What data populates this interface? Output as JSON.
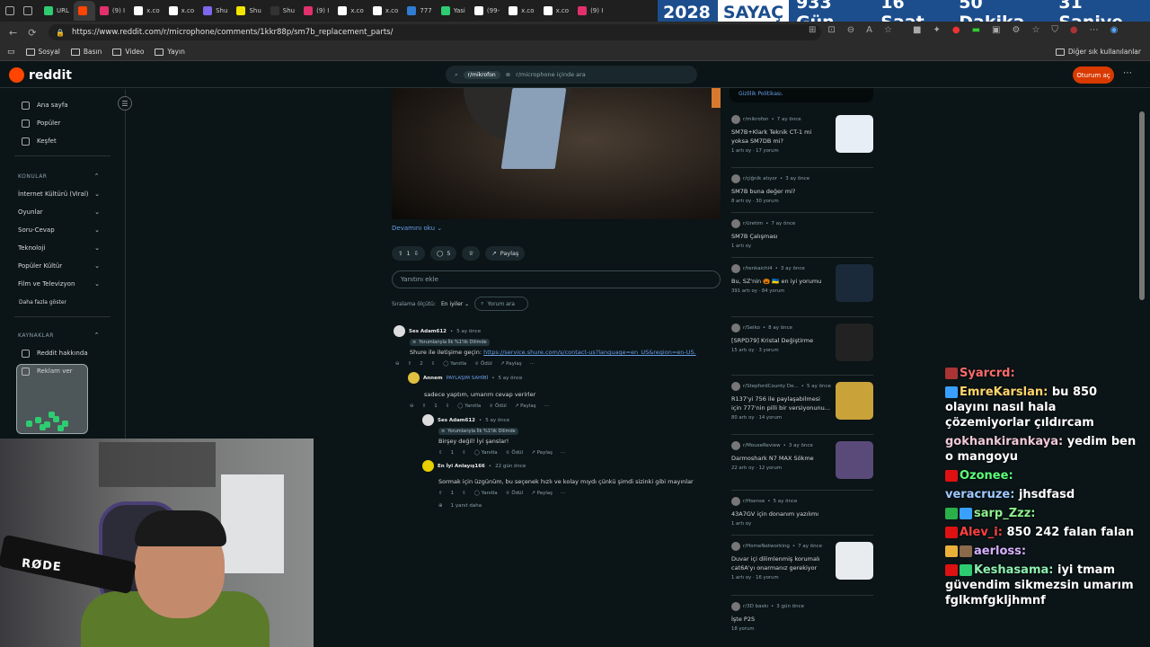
{
  "browser": {
    "tabs": [
      {
        "label": "URL",
        "color": "#2ecc71",
        "active": false
      },
      {
        "label": "",
        "color": "#ff4500",
        "active": true
      },
      {
        "label": "(9) I",
        "color": "#e1306c",
        "active": false
      },
      {
        "label": "x.co",
        "color": "#ffffff",
        "active": false
      },
      {
        "label": "x.co",
        "color": "#ffffff",
        "active": false
      },
      {
        "label": "Shu",
        "color": "#7b68ee",
        "active": false
      },
      {
        "label": "Shu",
        "color": "#f2e500",
        "active": false
      },
      {
        "label": "Shu",
        "color": "#333333",
        "active": false
      },
      {
        "label": "(9) I",
        "color": "#e1306c",
        "active": false
      },
      {
        "label": "x.co",
        "color": "#ffffff",
        "active": false
      },
      {
        "label": "x.co",
        "color": "#ffffff",
        "active": false
      },
      {
        "label": "777",
        "color": "#2e7dd1",
        "active": false
      },
      {
        "label": "Yasi",
        "color": "#2ecc71",
        "active": false
      },
      {
        "label": "(99-",
        "color": "#ffffff",
        "active": false
      },
      {
        "label": "x.co",
        "color": "#ffffff",
        "active": false
      },
      {
        "label": "x.co",
        "color": "#ffffff",
        "active": false
      },
      {
        "label": "(9) I",
        "color": "#e1306c",
        "active": false
      }
    ],
    "url": "https://www.reddit.com/r/microphone/comments/1kkr88p/sm7b_replacement_parts/",
    "bookmarks": [
      "Sosyal",
      "Basın",
      "Video",
      "Yayın"
    ],
    "other_bookmarks": "Diğer sık kullanılanlar"
  },
  "counter": {
    "year": "2028",
    "label": "SAYAÇ",
    "days": "933 Gün",
    "hours": "16 Saat",
    "minutes": "50 Dakika",
    "seconds": "31 Saniye"
  },
  "reddit": {
    "logo": "reddit",
    "search_chip": "r/mikrofon",
    "search_placeholder": "r/microphone içinde ara",
    "login": "Oturum aç",
    "nav": [
      "Ana sayfa",
      "Popüler",
      "Keşfet"
    ],
    "topics_header": "KONULAR",
    "topics": [
      "İnternet Kültürü (Viral)",
      "Oyunlar",
      "Soru-Cevap",
      "Teknoloji",
      "Popüler Kültür",
      "Film ve Televizyon"
    ],
    "more_topics": "Daha fazla göster",
    "resources_header": "KAYNAKLAR",
    "resources": [
      "Reddit hakkında",
      "Reklam ver"
    ],
    "readmore": "Devamını oku",
    "votes": "1",
    "comments_count": "5",
    "share": "Paylaş",
    "reply_placeholder": "Yanıtını ekle",
    "sort_label": "Sıralama ölçütü:",
    "sort_value": "En iyiler",
    "comment_search": "Yorum ara",
    "comments": [
      {
        "user": "Ses Adam612",
        "time": "5 ay önce",
        "badge": "Yorumlarıyla İlk %1'lik Dilimde",
        "text": "Shure ile iletişime geçin:",
        "link": "https://service.shure.com/s/contact-us?language=en_US&region=en-US.",
        "votes": "2",
        "reply": "Yanıtla",
        "award": "Ödül",
        "share": "Paylaş"
      },
      {
        "user": "Annem",
        "op": "PAYLAŞIM SAHİBİ",
        "time": "5 ay önce",
        "text": "sadece yaptım, umarım cevap verirler",
        "votes": "1",
        "reply": "Yanıtla",
        "award": "Ödül",
        "share": "Paylaş"
      },
      {
        "user": "Ses Adam612",
        "time": "5 ay önce",
        "badge": "Yorumlarıyla İlk %1'lik Dilimde",
        "text": "Birşey değil! İyi şanslar!",
        "votes": "1",
        "reply": "Yanıtla",
        "award": "Ödül",
        "share": "Paylaş"
      },
      {
        "user": "En İyi Anlayış166",
        "time": "22 gün önce",
        "text": "Sormak için üzgünüm, bu seçenek hızlı ve kolay mıydı çünkü şimdi sizinki gibi mayınlar",
        "votes": "1",
        "reply": "Yanıtla",
        "award": "Ödül",
        "share": "Paylaş",
        "more": "1 yanıt daha"
      }
    ],
    "privacy": "Gizlilik Politikası.",
    "related": [
      {
        "sub": "r/mikrofon",
        "time": "7 ay önce",
        "title": "SM7B+Klark Teknik CT-1 mi yoksa SM7DB mi?",
        "stats": "1 artı oy · 17 yorum",
        "thumb": true,
        "tcolor": "#e8eef5"
      },
      {
        "sub": "r/çiğnik atıyor",
        "time": "3 ay önce",
        "title": "SM7B buna değer mi?",
        "stats": "8 artı oy · 30 yorum",
        "thumb": false
      },
      {
        "sub": "r/üretim",
        "time": "7 ay önce",
        "title": "SM7B Çalışması",
        "stats": "1 artı oy",
        "thumb": false
      },
      {
        "sub": "r/tenkaichi4",
        "time": "3 ay önce",
        "title": "Bu, SZ'nin 🎃 🇺🇦 en iyi yorumu",
        "stats": "391 artı oy · 84 yorum",
        "thumb": true,
        "tcolor": "#1a2a3a"
      },
      {
        "sub": "r/Seiko",
        "time": "8 ay önce",
        "title": "[SRPD79] Kristal Değiştirme",
        "stats": "15 artı oy · 3 yorum",
        "thumb": true,
        "tcolor": "#222222"
      },
      {
        "sub": "r/StepfordCounty De...",
        "time": "5 ay önce",
        "title": "R137'yi 756 ile paylaşabilmesi için 777'nin pilli bir versiyonunu...",
        "stats": "80 artı oy · 14 yorum",
        "thumb": true,
        "tcolor": "#c9a23a"
      },
      {
        "sub": "r/MouseReview",
        "time": "3 ay önce",
        "title": "Darmoshark N7 MAX Sökme",
        "stats": "22 artı oy · 12 yorum",
        "thumb": true,
        "tcolor": "#5a4a7a"
      },
      {
        "sub": "r/Hsense",
        "time": "5 ay önce",
        "title": "43A7GV için donanım yazılımı",
        "stats": "1 artı oy",
        "thumb": false
      },
      {
        "sub": "r/HomeNetworking",
        "time": "7 ay önce",
        "title": "Duvar içi dilimlenmiş korumalı cat6A'yı onarmanız gerekiyor",
        "stats": "1 artı oy · 16 yorum",
        "thumb": true,
        "tcolor": "#e8ecef"
      },
      {
        "sub": "r/3D baskı",
        "time": "3 gün önce",
        "title": "İşte P2S",
        "stats": "18 yorum",
        "thumb": false
      }
    ]
  },
  "chat": [
    {
      "user": "Syarcrd:",
      "color": "#ff6b6b",
      "text": "",
      "icons": [
        "#a33"
      ]
    },
    {
      "user": "EmreKarslan:",
      "color": "#ffd56b",
      "text": "bu 850 olayını nasıl hala çözemiyorlar çıldırcam",
      "icons": [
        "#3aa0ff"
      ]
    },
    {
      "user": "gokhankirankaya:",
      "color": "#f0c8d8",
      "text": "yedim ben o mangoyu",
      "icons": []
    },
    {
      "user": "Ozonee:",
      "color": "#5cff7a",
      "text": "",
      "icons": [
        "#d11"
      ]
    },
    {
      "user": "veracruze:",
      "color": "#9ec9ff",
      "text": "jhsdfasd",
      "icons": []
    },
    {
      "user": "sarp_Zzz:",
      "color": "#8ef08e",
      "text": "",
      "icons": [
        "#2ab04a",
        "#3aa0ff"
      ]
    },
    {
      "user": "Alev_i:",
      "color": "#ff4040",
      "text": "850 242 falan falan",
      "icons": [
        "#d11"
      ]
    },
    {
      "user": "aerloss:",
      "color": "#d6b0ff",
      "text": "",
      "icons": [
        "#e8b23a",
        "#8a6a4a"
      ]
    },
    {
      "user": "Keshasama:",
      "color": "#8ef0b0",
      "text": "iyi tmam güvendim sikmezsin umarım fglkmfgkljhmnf",
      "icons": [
        "#d11",
        "#2ecc71"
      ]
    }
  ]
}
